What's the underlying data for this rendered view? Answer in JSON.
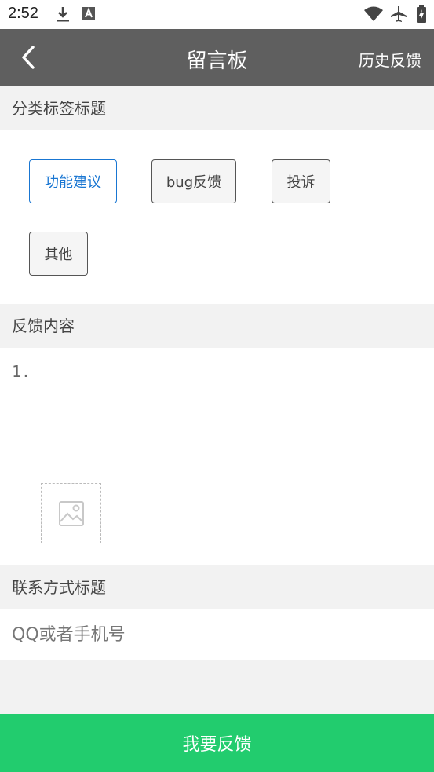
{
  "status_bar": {
    "time": "2:52",
    "icons": [
      "download-icon",
      "a-box-icon",
      "wifi-icon",
      "airplane-icon",
      "battery-charging-icon"
    ]
  },
  "app_bar": {
    "back_icon": "chevron-left-icon",
    "title": "留言板",
    "history_label": "历史反馈"
  },
  "category": {
    "title": "分类标签标题",
    "tags": [
      {
        "label": "功能建议",
        "selected": true
      },
      {
        "label": "bug反馈",
        "selected": false
      },
      {
        "label": "投诉",
        "selected": false
      },
      {
        "label": "其他",
        "selected": false
      }
    ]
  },
  "feedback": {
    "title": "反馈内容",
    "content": "1.",
    "add_image_icon": "image-placeholder-icon"
  },
  "contact": {
    "title": "联系方式标题",
    "placeholder": "QQ或者手机号"
  },
  "submit_label": "我要反馈",
  "colors": {
    "app_bar": "#5f5f5f",
    "accent": "#1976d2",
    "submit": "#22cc6e"
  }
}
